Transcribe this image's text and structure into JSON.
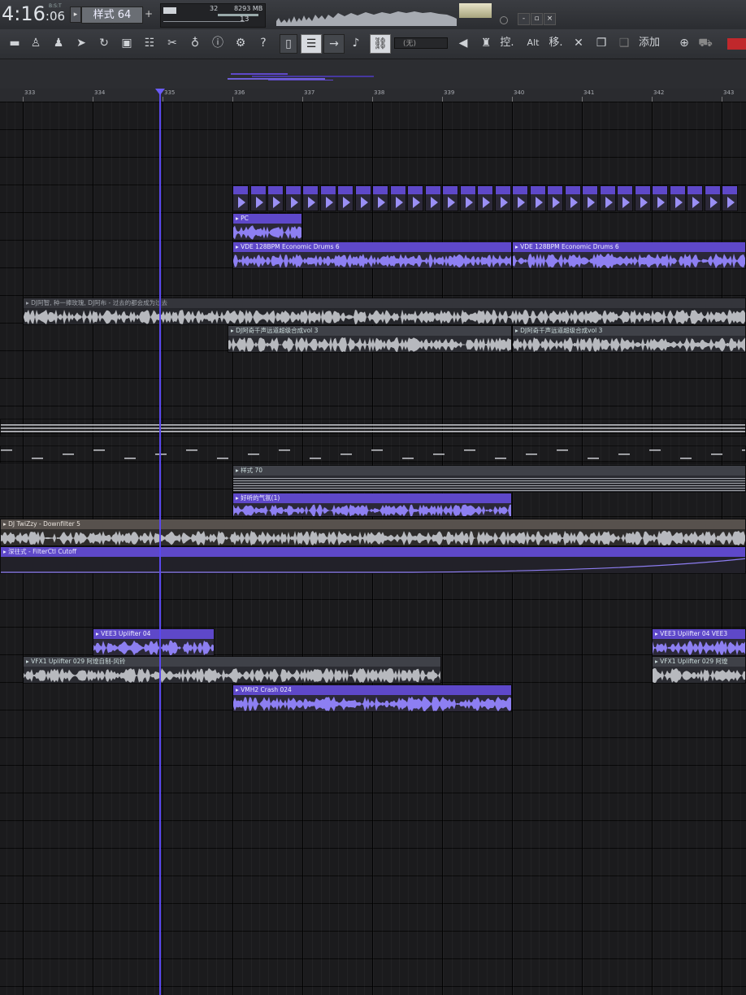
{
  "top_bar": {
    "time_main": "4:16",
    "time_sub": ":06",
    "time_small": "B:S:T",
    "pattern_label": "样式 64",
    "tempo_value": "32",
    "memory": "8293 MB",
    "polyphony": "13",
    "window_buttons": [
      "-",
      "▫",
      "×"
    ]
  },
  "toolbar": {
    "snap_label": "(无)",
    "ctrl_label": "控.",
    "alt_label": "Alt",
    "move_label": "移.",
    "add_label": "添加"
  },
  "ruler": {
    "bars": [
      "333",
      "334",
      "335",
      "336",
      "337",
      "338",
      "339",
      "340",
      "341",
      "342",
      "343"
    ]
  },
  "clips": [
    {
      "id": "pc",
      "label": "PC",
      "style": "purple"
    },
    {
      "id": "vde1",
      "label": "VDE 128BPM Economic Drums 6",
      "style": "purple"
    },
    {
      "id": "vde2",
      "label": "VDE 128BPM Economic Drums 6",
      "style": "purple"
    },
    {
      "id": "dj-long",
      "label": "DJ阿智, 种一捧玫瑰, DJ阿布 - 过去的都会成为过去",
      "style": "dim"
    },
    {
      "id": "dj-a",
      "label": "DJ阿奇千声远道超级合成vol 3",
      "style": "gray"
    },
    {
      "id": "dj-b",
      "label": "DJ阿奇千声远道超级合成vol 3",
      "style": "gray"
    },
    {
      "id": "pat70",
      "label": "样式 70",
      "style": "gray"
    },
    {
      "id": "hao",
      "label": "好听的气氛(1)",
      "style": "purple"
    },
    {
      "id": "twizzy",
      "label": "DJ TwiZzy - Downfilter 5",
      "style": "tan"
    },
    {
      "id": "filter",
      "label": "深往式 - FilterCtl Cutoff",
      "style": "auto"
    },
    {
      "id": "vee-a",
      "label": "VEE3 Uplifter 04",
      "style": "purple"
    },
    {
      "id": "vee-b",
      "label": "VEE3 Uplifter 04  VEE3",
      "style": "purple"
    },
    {
      "id": "vfx-a",
      "label": "VFX1 Uplifter 029  阿煌自制-风铃",
      "style": "gray"
    },
    {
      "id": "vfx-b",
      "label": "VFX1 Uplifter 029  阿煌",
      "style": "gray"
    },
    {
      "id": "crash",
      "label": "VMH2 Crash 024",
      "style": "purple"
    }
  ],
  "colors": {
    "accent": "#5e48c9",
    "playhead": "#5a48f0",
    "background": "#1b1b1d"
  }
}
